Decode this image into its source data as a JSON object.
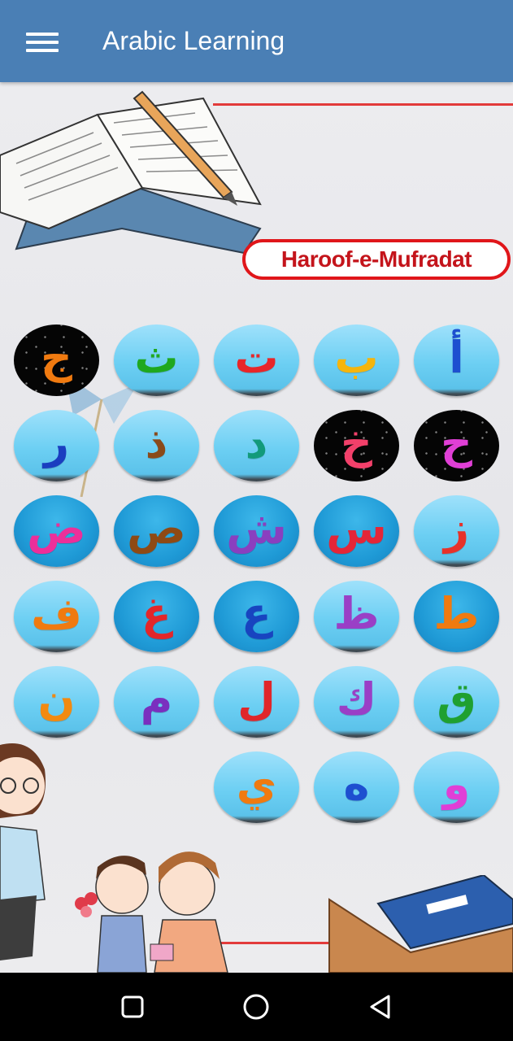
{
  "app_bar": {
    "title": "Arabic Learning",
    "menu_icon": "hamburger-menu-icon",
    "color": "#4a7fb5"
  },
  "banner": {
    "text": "Haroof-e-Mufradat",
    "border_color": "#e0161a"
  },
  "letters": [
    {
      "char": "ج",
      "color": "#f07a10",
      "bg": "dark"
    },
    {
      "char": "ث",
      "color": "#1fa81f",
      "bg": "light"
    },
    {
      "char": "ت",
      "color": "#e8262a",
      "bg": "light"
    },
    {
      "char": "ب",
      "color": "#f5b50c",
      "bg": "light"
    },
    {
      "char": "أ",
      "color": "#1d4fd0",
      "bg": "light"
    },
    {
      "char": "ر",
      "color": "#1a3ec0",
      "bg": "light"
    },
    {
      "char": "ذ",
      "color": "#8a4a1a",
      "bg": "light"
    },
    {
      "char": "د",
      "color": "#129a7a",
      "bg": "light"
    },
    {
      "char": "خ",
      "color": "#f2406a",
      "bg": "dark"
    },
    {
      "char": "ح",
      "color": "#e03fd6",
      "bg": "dark"
    },
    {
      "char": "ض",
      "color": "#ec2f9a",
      "bg": "deep"
    },
    {
      "char": "ص",
      "color": "#8f4a14",
      "bg": "deep"
    },
    {
      "char": "ش",
      "color": "#8a3fbf",
      "bg": "deep"
    },
    {
      "char": "س",
      "color": "#e42638",
      "bg": "deep"
    },
    {
      "char": "ز",
      "color": "#e7322a",
      "bg": "light"
    },
    {
      "char": "ف",
      "color": "#f07a10",
      "bg": "light"
    },
    {
      "char": "غ",
      "color": "#e3262a",
      "bg": "deep"
    },
    {
      "char": "ع",
      "color": "#1844c0",
      "bg": "deep"
    },
    {
      "char": "ظ",
      "color": "#9a3fc6",
      "bg": "light"
    },
    {
      "char": "ط",
      "color": "#f07a10",
      "bg": "deep"
    },
    {
      "char": "ن",
      "color": "#f28a10",
      "bg": "light"
    },
    {
      "char": "م",
      "color": "#7a2fbf",
      "bg": "light"
    },
    {
      "char": "ل",
      "color": "#e0262a",
      "bg": "light"
    },
    {
      "char": "ك",
      "color": "#9a3fc6",
      "bg": "light"
    },
    {
      "char": "ق",
      "color": "#1fa030",
      "bg": "light"
    },
    {
      "char": "ي",
      "color": "#f07a10",
      "bg": "light"
    },
    {
      "char": "ه",
      "color": "#1e4fd0",
      "bg": "light"
    },
    {
      "char": "و",
      "color": "#e03fd6",
      "bg": "light"
    }
  ],
  "nav_bar": {
    "recents_icon": "recents-square-icon",
    "home_icon": "home-circle-icon",
    "back_icon": "back-triangle-icon"
  }
}
